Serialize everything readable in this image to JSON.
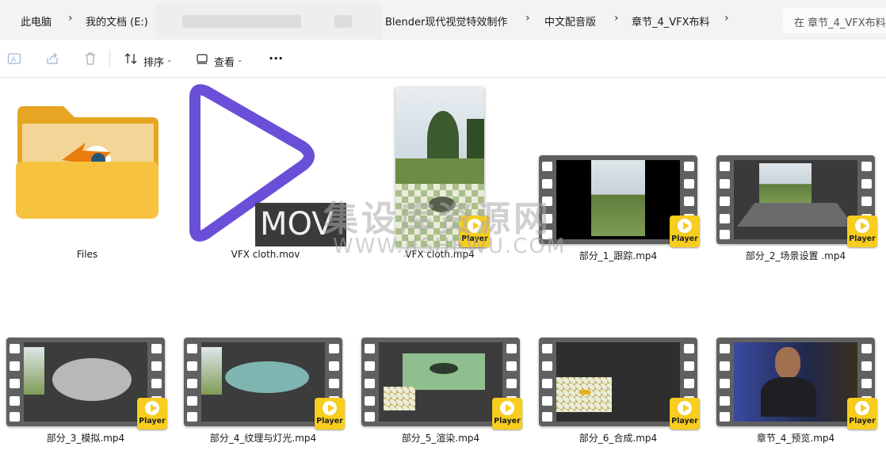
{
  "breadcrumb": {
    "items": [
      "此电脑",
      "我的文档 (E:)",
      "Blender现代视觉特效制作",
      "中文配音版",
      "章节_4_VFX布料"
    ]
  },
  "search": {
    "placeholder": "在 章节_4_VFX布料"
  },
  "toolbar": {
    "sort_label": "排序",
    "view_label": "查看",
    "more_label": "···"
  },
  "files": [
    {
      "name": "Files",
      "type": "folder"
    },
    {
      "name": "VFX cloth.mov",
      "type": "mov",
      "badge": "MOV"
    },
    {
      "name": "VFX cloth.mp4",
      "type": "video"
    },
    {
      "name": "部分_1_跟踪.mp4",
      "type": "video"
    },
    {
      "name": "部分_2_场景设置 .mp4",
      "type": "video"
    },
    {
      "name": "部分_3_模拟.mp4",
      "type": "video"
    },
    {
      "name": "部分_4_纹理与灯光.mp4",
      "type": "video"
    },
    {
      "name": "部分_5_渲染.mp4",
      "type": "video"
    },
    {
      "name": "部分_6_合成.mp4",
      "type": "video"
    },
    {
      "name": "章节_4_预览.mp4",
      "type": "video"
    }
  ],
  "player_badge": "Player",
  "watermark": {
    "line1": "集设库资源网",
    "line2": "WWW.JISHEWU.COM"
  },
  "colors": {
    "accent_purple": "#6a4fd8",
    "player_yellow": "#f7cd1e",
    "folder_yellow": "#f6c240"
  }
}
